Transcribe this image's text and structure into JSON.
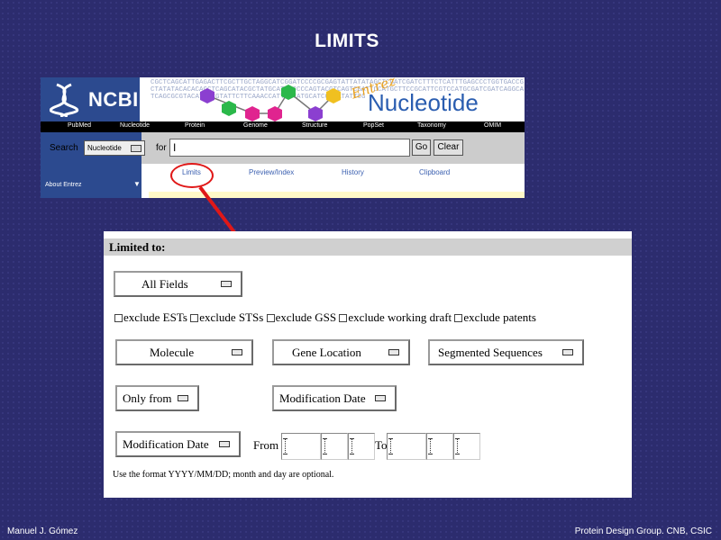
{
  "slide": {
    "title": "LIMITS",
    "footer_left": "Manuel J. Gómez",
    "footer_right": "Protein Design Group. CNB, CSIC"
  },
  "ncbi": {
    "logo_text": "NCBI",
    "entrez_text": "Entrez",
    "product_text": "Nucleotide",
    "sequence_text": "CGCTCAGCATTGAGACTTCGCTTGCTAGGCATCGGATCCCCGCGAGTATTATATAGCTCGATCGATCTTTCTCATTTGAGCCCTGGTGACCGCTATATACACACAGCTCAGCATACGCTATGCATATCCCCAGTACGTCAGTCGATTCCATGCTTCCGCATTCGTCCATGCGATCGATCAGGCATCAGCGCGTACATTACGTATTCTTCAAACCATTCGTATGCATCGGCATATTCG",
    "nav_items": [
      "PubMed",
      "Nucleotide",
      "Protein",
      "Genome",
      "Structure",
      "PopSet",
      "Taxonomy",
      "OMIM"
    ],
    "search_label": "Search",
    "db_value": "Nucleotide",
    "for_label": "for",
    "term_value": "I",
    "go_label": "Go",
    "clear_label": "Clear",
    "tabs": [
      "Limits",
      "Preview/Index",
      "History",
      "Clipboard"
    ],
    "sidebar_text": "About Entrez"
  },
  "limits": {
    "header": "Limited to:",
    "field_select": "All Fields",
    "checkboxes": [
      {
        "label": "exclude ESTs",
        "checked": false
      },
      {
        "label": "exclude STSs",
        "checked": false
      },
      {
        "label": "exclude GSS",
        "checked": false
      },
      {
        "label": "exclude working draft",
        "checked": false
      },
      {
        "label": "exclude patents",
        "checked": false
      }
    ],
    "molecule_select": "Molecule",
    "gene_location_select": "Gene Location",
    "segmented_select": "Segmented Sequences",
    "only_from_select": "Only from",
    "mod_date_select": "Modification Date",
    "date_type_select": "Modification Date",
    "from_label": "From",
    "to_label": "To",
    "format_note": "Use the format YYYY/MM/DD; month and day are optional."
  },
  "colors": {
    "slide_background": "#2c2c6e",
    "annotation_red": "#e01818",
    "ncbi_blue": "#2c4a8f",
    "nucleotide_blue": "#2a5db0",
    "tab_link_blue": "#3a5fb0"
  }
}
